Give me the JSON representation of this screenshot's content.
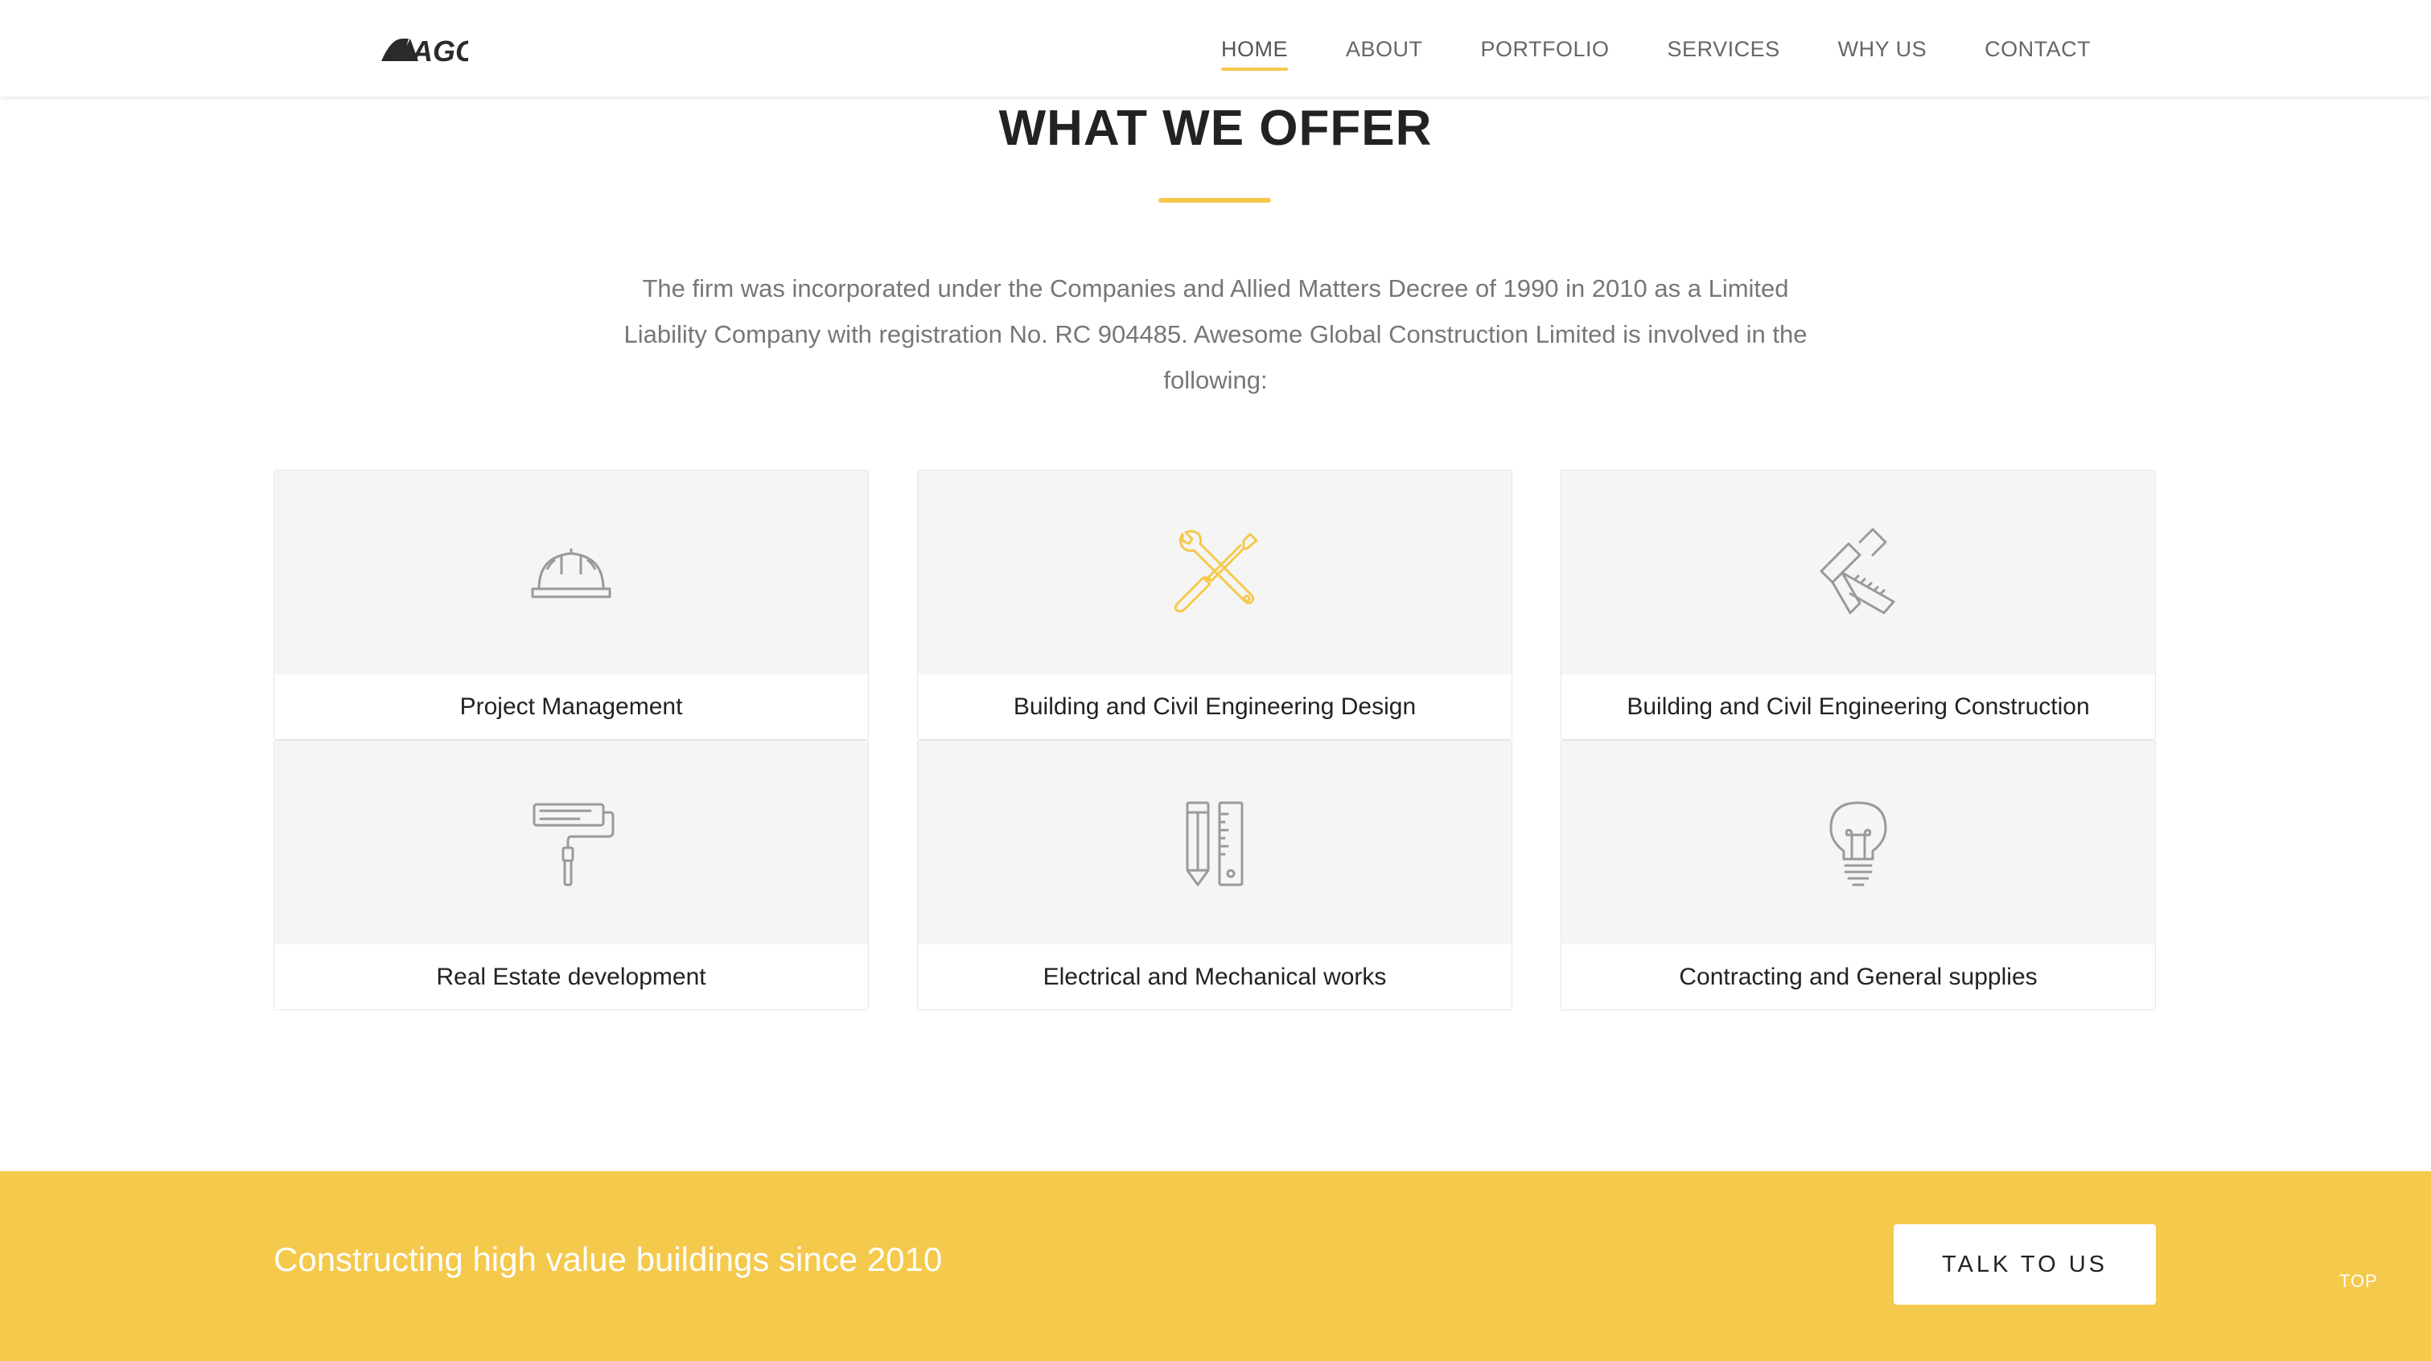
{
  "brand": {
    "logo_text": "AGC",
    "accent_color": "#f5c94c"
  },
  "nav": {
    "items": [
      {
        "label": "HOME",
        "active": true
      },
      {
        "label": "ABOUT",
        "active": false
      },
      {
        "label": "PORTFOLIO",
        "active": false
      },
      {
        "label": "SERVICES",
        "active": false
      },
      {
        "label": "WHY US",
        "active": false
      },
      {
        "label": "CONTACT",
        "active": false
      }
    ]
  },
  "offer": {
    "title": "WHAT WE OFFER",
    "intro_lines": [
      "The firm was incorporated under the Companies and Allied Matters Decree of 1990 in 2010 as a Limited",
      "Liability Company with registration No. RC 904485. Awesome Global Construction Limited is involved in the",
      "following:"
    ],
    "services": [
      {
        "label": "Project Management",
        "icon": "hard-hat-icon",
        "highlighted": false
      },
      {
        "label": "Building and Civil Engineering Design",
        "icon": "wrench-screwdriver-icon",
        "highlighted": true
      },
      {
        "label": "Building and Civil Engineering Construction",
        "icon": "hammer-ruler-icon",
        "highlighted": false
      },
      {
        "label": "Real Estate development",
        "icon": "paint-roller-icon",
        "highlighted": false
      },
      {
        "label": "Electrical and Mechanical works",
        "icon": "pencil-ruler-icon",
        "highlighted": false
      },
      {
        "label": "Contracting and General supplies",
        "icon": "lightbulb-icon",
        "highlighted": false
      }
    ],
    "icon_color": "#9a9a9a",
    "icon_highlight_color": "#f5c94c"
  },
  "cta": {
    "text": "Constructing high value buildings since 2010",
    "button_label": "TALK TO US",
    "top_label": "TOP"
  }
}
